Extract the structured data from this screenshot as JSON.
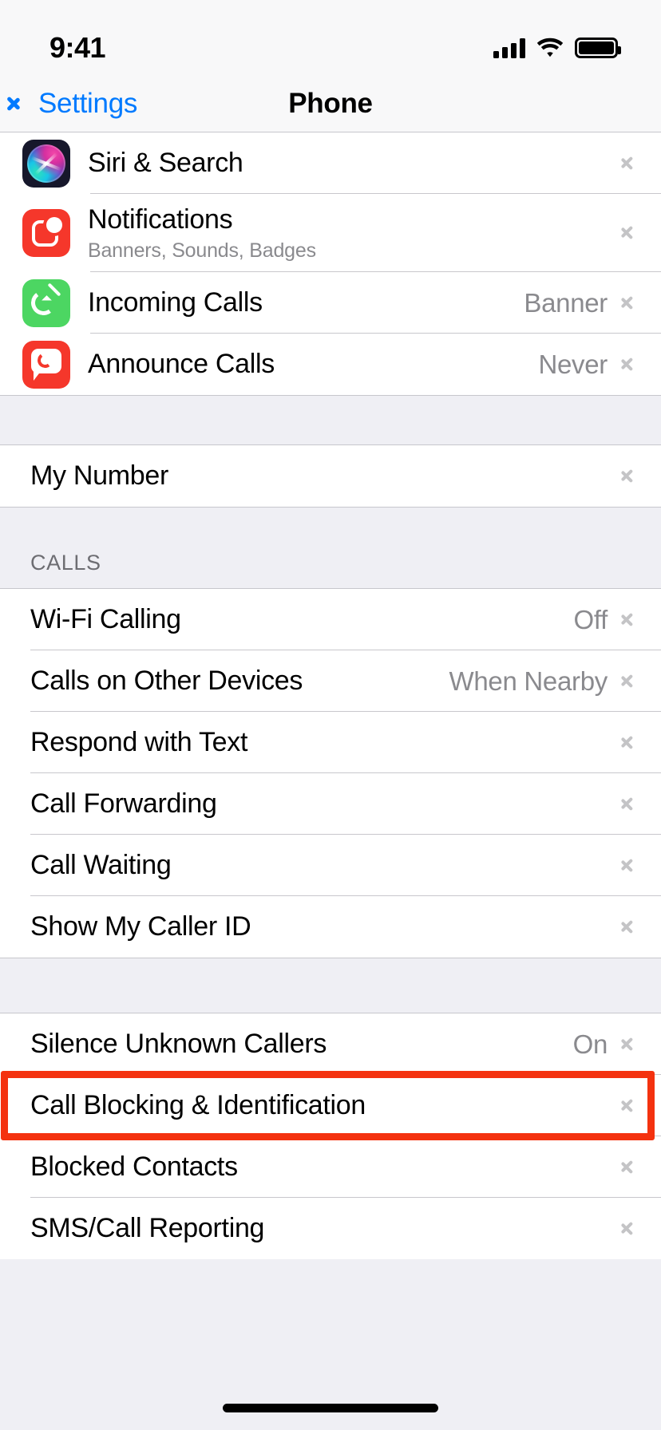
{
  "status_bar": {
    "time": "9:41",
    "cellular_icon": "signal-bars-icon",
    "wifi_icon": "wifi-icon",
    "battery_icon": "battery-full-icon"
  },
  "nav": {
    "back_label": "Settings",
    "back_icon": "chevron-left-icon",
    "title": "Phone"
  },
  "sections": [
    {
      "header": "",
      "rows": [
        {
          "icon": "siri-icon",
          "label": "Siri & Search",
          "sub": "",
          "value": ""
        },
        {
          "icon": "notifications-icon",
          "label": "Notifications",
          "sub": "Banners, Sounds, Badges",
          "value": ""
        },
        {
          "icon": "incoming-calls-icon",
          "label": "Incoming Calls",
          "sub": "",
          "value": "Banner"
        },
        {
          "icon": "announce-calls-icon",
          "label": "Announce Calls",
          "sub": "",
          "value": "Never"
        }
      ]
    },
    {
      "header": "",
      "rows": [
        {
          "icon": "",
          "label": "My Number",
          "sub": "",
          "value": ""
        }
      ]
    },
    {
      "header": "CALLS",
      "rows": [
        {
          "icon": "",
          "label": "Wi-Fi Calling",
          "sub": "",
          "value": "Off"
        },
        {
          "icon": "",
          "label": "Calls on Other Devices",
          "sub": "",
          "value": "When Nearby"
        },
        {
          "icon": "",
          "label": "Respond with Text",
          "sub": "",
          "value": ""
        },
        {
          "icon": "",
          "label": "Call Forwarding",
          "sub": "",
          "value": ""
        },
        {
          "icon": "",
          "label": "Call Waiting",
          "sub": "",
          "value": ""
        },
        {
          "icon": "",
          "label": "Show My Caller ID",
          "sub": "",
          "value": ""
        }
      ]
    },
    {
      "header": "",
      "rows": [
        {
          "icon": "",
          "label": "Silence Unknown Callers",
          "sub": "",
          "value": "On"
        },
        {
          "icon": "",
          "label": "Call Blocking & Identification",
          "sub": "",
          "value": "",
          "highlighted": true
        },
        {
          "icon": "",
          "label": "Blocked Contacts",
          "sub": "",
          "value": ""
        },
        {
          "icon": "",
          "label": "SMS/Call Reporting",
          "sub": "",
          "value": ""
        }
      ]
    }
  ],
  "highlight": {
    "color": "#F4320F",
    "target_label": "Call Blocking & Identification"
  },
  "colors": {
    "accent_blue": "#007AFF",
    "group_background": "#EFEFF4",
    "row_background": "#FFFFFF",
    "separator": "#C8C7CC",
    "secondary_text": "#8A8A8E",
    "header_text": "#6D6D72",
    "highlight_red": "#F4320F"
  },
  "home_indicator": "home-indicator-bar"
}
